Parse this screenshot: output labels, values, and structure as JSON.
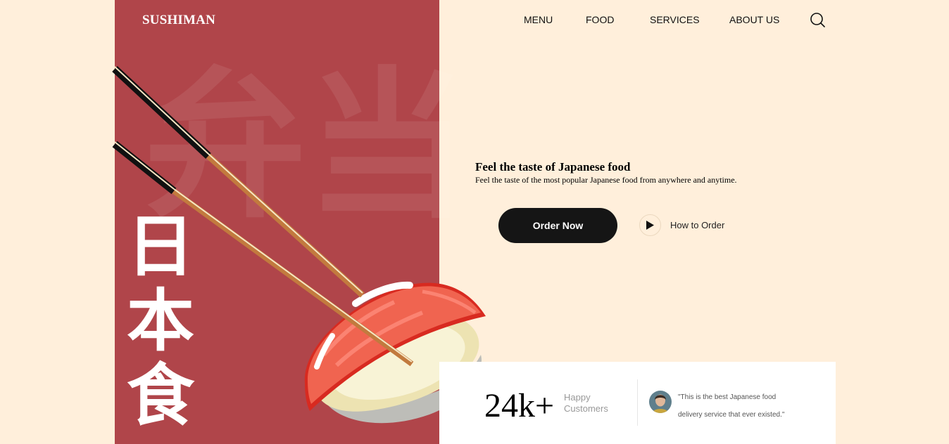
{
  "brand": "SUSHIMAN",
  "nav": [
    "MENU",
    "FOOD",
    "SERVICES",
    "ABOUT US"
  ],
  "watermark": "弁当",
  "vertical_text": [
    "日",
    "本",
    "食"
  ],
  "hero": {
    "title": "Feel the taste of Japanese food",
    "subtitle": "Feel the taste of the most popular Japanese food from anywhere and anytime."
  },
  "cta": {
    "primary": "Order Now",
    "secondary": "How to Order"
  },
  "stats": {
    "count": "24k+",
    "label_line1": "Happy",
    "label_line2": "Customers",
    "quote": "\"This is the best Japanese food delivery service that ever existed.\""
  },
  "icons": {
    "search": "search-icon",
    "play": "play-icon"
  },
  "colors": {
    "accent": "#B0454A",
    "background": "#FFEFDB",
    "button": "#151515",
    "salmon": "#F06450"
  }
}
